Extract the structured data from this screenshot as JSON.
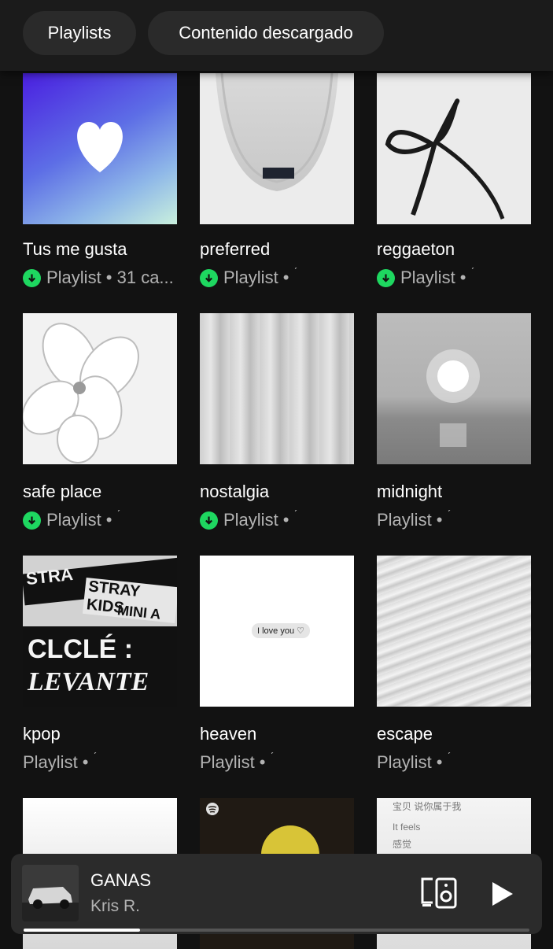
{
  "filters": {
    "playlists": "Playlists",
    "downloaded": "Contenido descargado"
  },
  "playlists": [
    {
      "title": "Tus me gusta",
      "subtitle": "Playlist • 31 ca...",
      "downloaded": true
    },
    {
      "title": "preferred",
      "subtitle": "Playlist •",
      "downloaded": true
    },
    {
      "title": "reggaeton",
      "subtitle": "Playlist •",
      "downloaded": true
    },
    {
      "title": "safe place",
      "subtitle": "Playlist •",
      "downloaded": true
    },
    {
      "title": "nostalgia",
      "subtitle": "Playlist •",
      "downloaded": true
    },
    {
      "title": "midnight",
      "subtitle": "Playlist •",
      "downloaded": false
    },
    {
      "title": "kpop",
      "subtitle": "Playlist •",
      "downloaded": false
    },
    {
      "title": "heaven",
      "subtitle": "Playlist •",
      "downloaded": false
    },
    {
      "title": "escape",
      "subtitle": "Playlist •",
      "downloaded": false
    }
  ],
  "artwork_text": {
    "kpop_lines": [
      "STRA",
      "STRAY KIDS",
      "MINI A",
      "CLCLÉ :",
      "LEVANTE"
    ],
    "heaven_bubble": "I love you ♡",
    "row4_right_lines": [
      "宝贝 说你属于我",
      "It feels",
      "感觉"
    ]
  },
  "now_playing": {
    "song": "GANAS",
    "artist": "Kris R.",
    "progress": 0.23
  },
  "colors": {
    "accent": "#1ed760",
    "background": "#121212",
    "player": "#2b2b2b"
  }
}
